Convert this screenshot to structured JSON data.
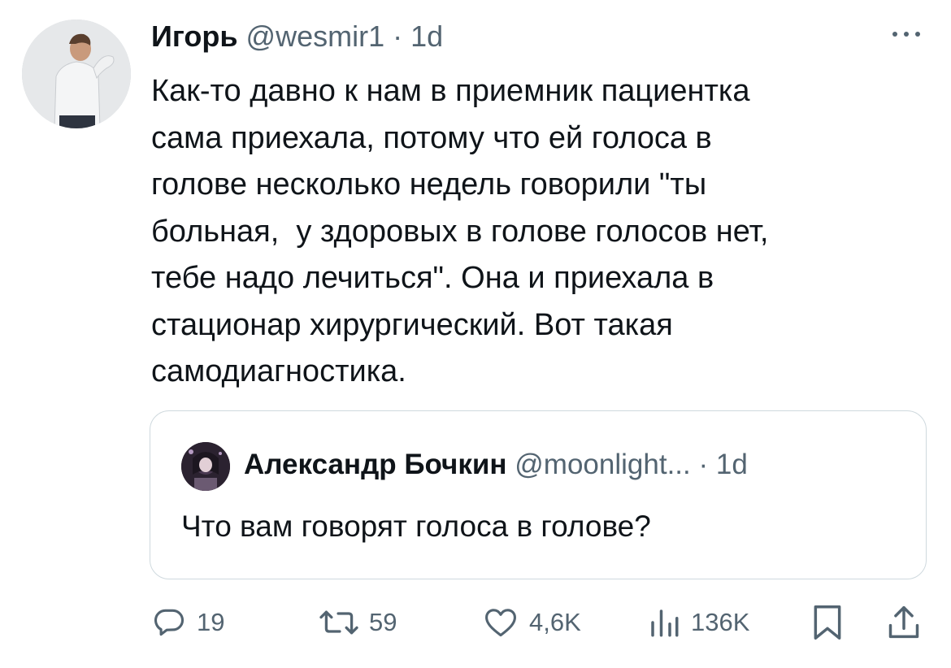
{
  "tweet": {
    "author_name": "Игорь",
    "handle": "@wesmir1",
    "separator": "·",
    "time": "1d",
    "more_icon": "ellipsis-icon",
    "text": "Как-то давно к нам в приемник пациентка\nсама приехала, потому что ей голоса в\nголове несколько недель говорили \"ты\nбольная,  у здоровых в голове голосов нет,\nтебе надо лечиться\". Она и приехала в\nстационар хирургический. Вот такая\nсамодиагностика."
  },
  "quoted": {
    "author_name": "Александр Бочкин",
    "handle": "@moonlight...",
    "separator": "·",
    "time": "1d",
    "text": "Что вам говорят голоса в голове?"
  },
  "actions": {
    "replies": "19",
    "reposts": "59",
    "likes": "4,6K",
    "views": "136K",
    "icons": [
      "reply-icon",
      "repost-icon",
      "like-icon",
      "views-icon",
      "bookmark-icon",
      "share-icon"
    ]
  },
  "colors": {
    "text": "#0f1419",
    "muted": "#536471",
    "border": "#cfd9de"
  }
}
